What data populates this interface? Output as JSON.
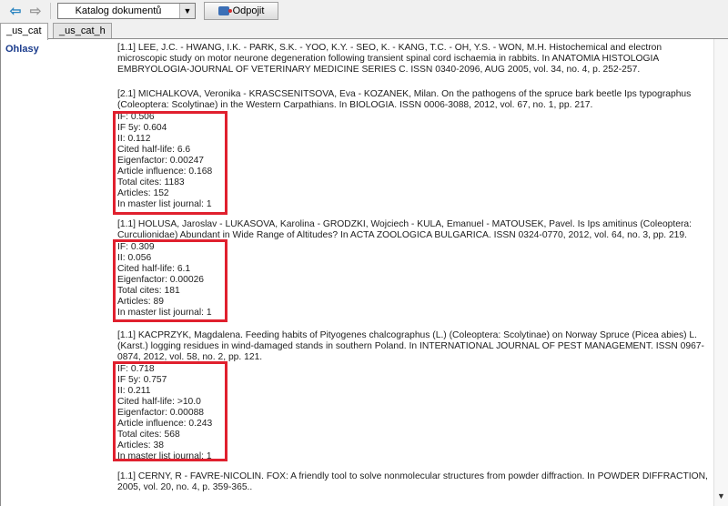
{
  "toolbar": {
    "back_icon": "arrow-left-icon",
    "forward_icon": "arrow-right-icon",
    "catalog_value": "Katalog dokumentů",
    "disconnect_label": "Odpojit"
  },
  "tabs": [
    "_us_cat",
    "_us_cat_h"
  ],
  "section_label": "Ohlasy",
  "records": [
    {
      "citation": "[1.1] LEE, J.C. - HWANG, I.K. - PARK, S.K. - YOO, K.Y. - SEO, K. - KANG, T.C. - OH, Y.S. - WON, M.H. Histochemical and electron microscopic study on motor neurone degeneration following transient spinal cord ischaemia in rabbits. In ANATOMIA HISTOLOGIA EMBRYOLOGIA-JOURNAL OF VETERINARY MEDICINE SERIES C. ISSN 0340-2096, AUG 2005, vol. 34, no. 4, p. 252-257.",
      "stats": []
    },
    {
      "citation": "[2.1] MICHALKOVA, Veronika - KRASCSENITSOVA, Eva - KOZANEK, Milan. On the pathogens of the spruce bark beetle Ips typographus (Coleoptera: Scolytinae) in the Western Carpathians. In BIOLOGIA. ISSN 0006-3088, 2012, vol. 67, no. 1, pp. 217.",
      "stats": [
        "IF: 0.506",
        "IF 5y: 0.604",
        "II: 0.112",
        "Cited half-life: 6.6",
        "Eigenfactor: 0.00247",
        "Article influence: 0.168",
        "Total cites: 1183",
        "Articles: 152",
        "In master list journal: 1"
      ]
    },
    {
      "citation": "[1.1] HOLUSA, Jaroslav - LUKASOVA, Karolina - GRODZKI, Wojciech - KULA, Emanuel - MATOUSEK, Pavel. Is Ips amitinus (Coleoptera: Curculionidae) Abundant in Wide Range of Altitudes? In ACTA ZOOLOGICA BULGARICA. ISSN 0324-0770, 2012, vol. 64, no. 3, pp. 219.",
      "stats": [
        "IF: 0.309",
        "II: 0.056",
        "Cited half-life: 6.1",
        "Eigenfactor: 0.00026",
        "Total cites: 181",
        "Articles: 89",
        "In master list journal: 1"
      ]
    },
    {
      "citation": "[1.1] KACPRZYK, Magdalena. Feeding habits of Pityogenes chalcographus (L.) (Coleoptera: Scolytinae) on Norway Spruce (Picea abies) L. (Karst.) logging residues in wind-damaged stands in southern Poland. In INTERNATIONAL JOURNAL OF PEST MANAGEMENT. ISSN 0967-0874, 2012, vol. 58, no. 2, pp. 121.",
      "stats": [
        "IF: 0.718",
        "IF 5y: 0.757",
        "II: 0.211",
        "Cited half-life: >10.0",
        "Eigenfactor: 0.00088",
        "Article influence: 0.243",
        "Total cites: 568",
        "Articles: 38",
        "In master list journal: 1"
      ]
    },
    {
      "citation": "[1.1] CERNY, R - FAVRE-NICOLIN. FOX: A friendly tool to solve nonmolecular structures from powder diffraction. In POWDER DIFFRACTION, 2005, vol. 20, no. 4, p. 359-365..",
      "stats": []
    }
  ],
  "colors": {
    "highlight": "#e0202e",
    "section_label": "#1a3b8c"
  }
}
